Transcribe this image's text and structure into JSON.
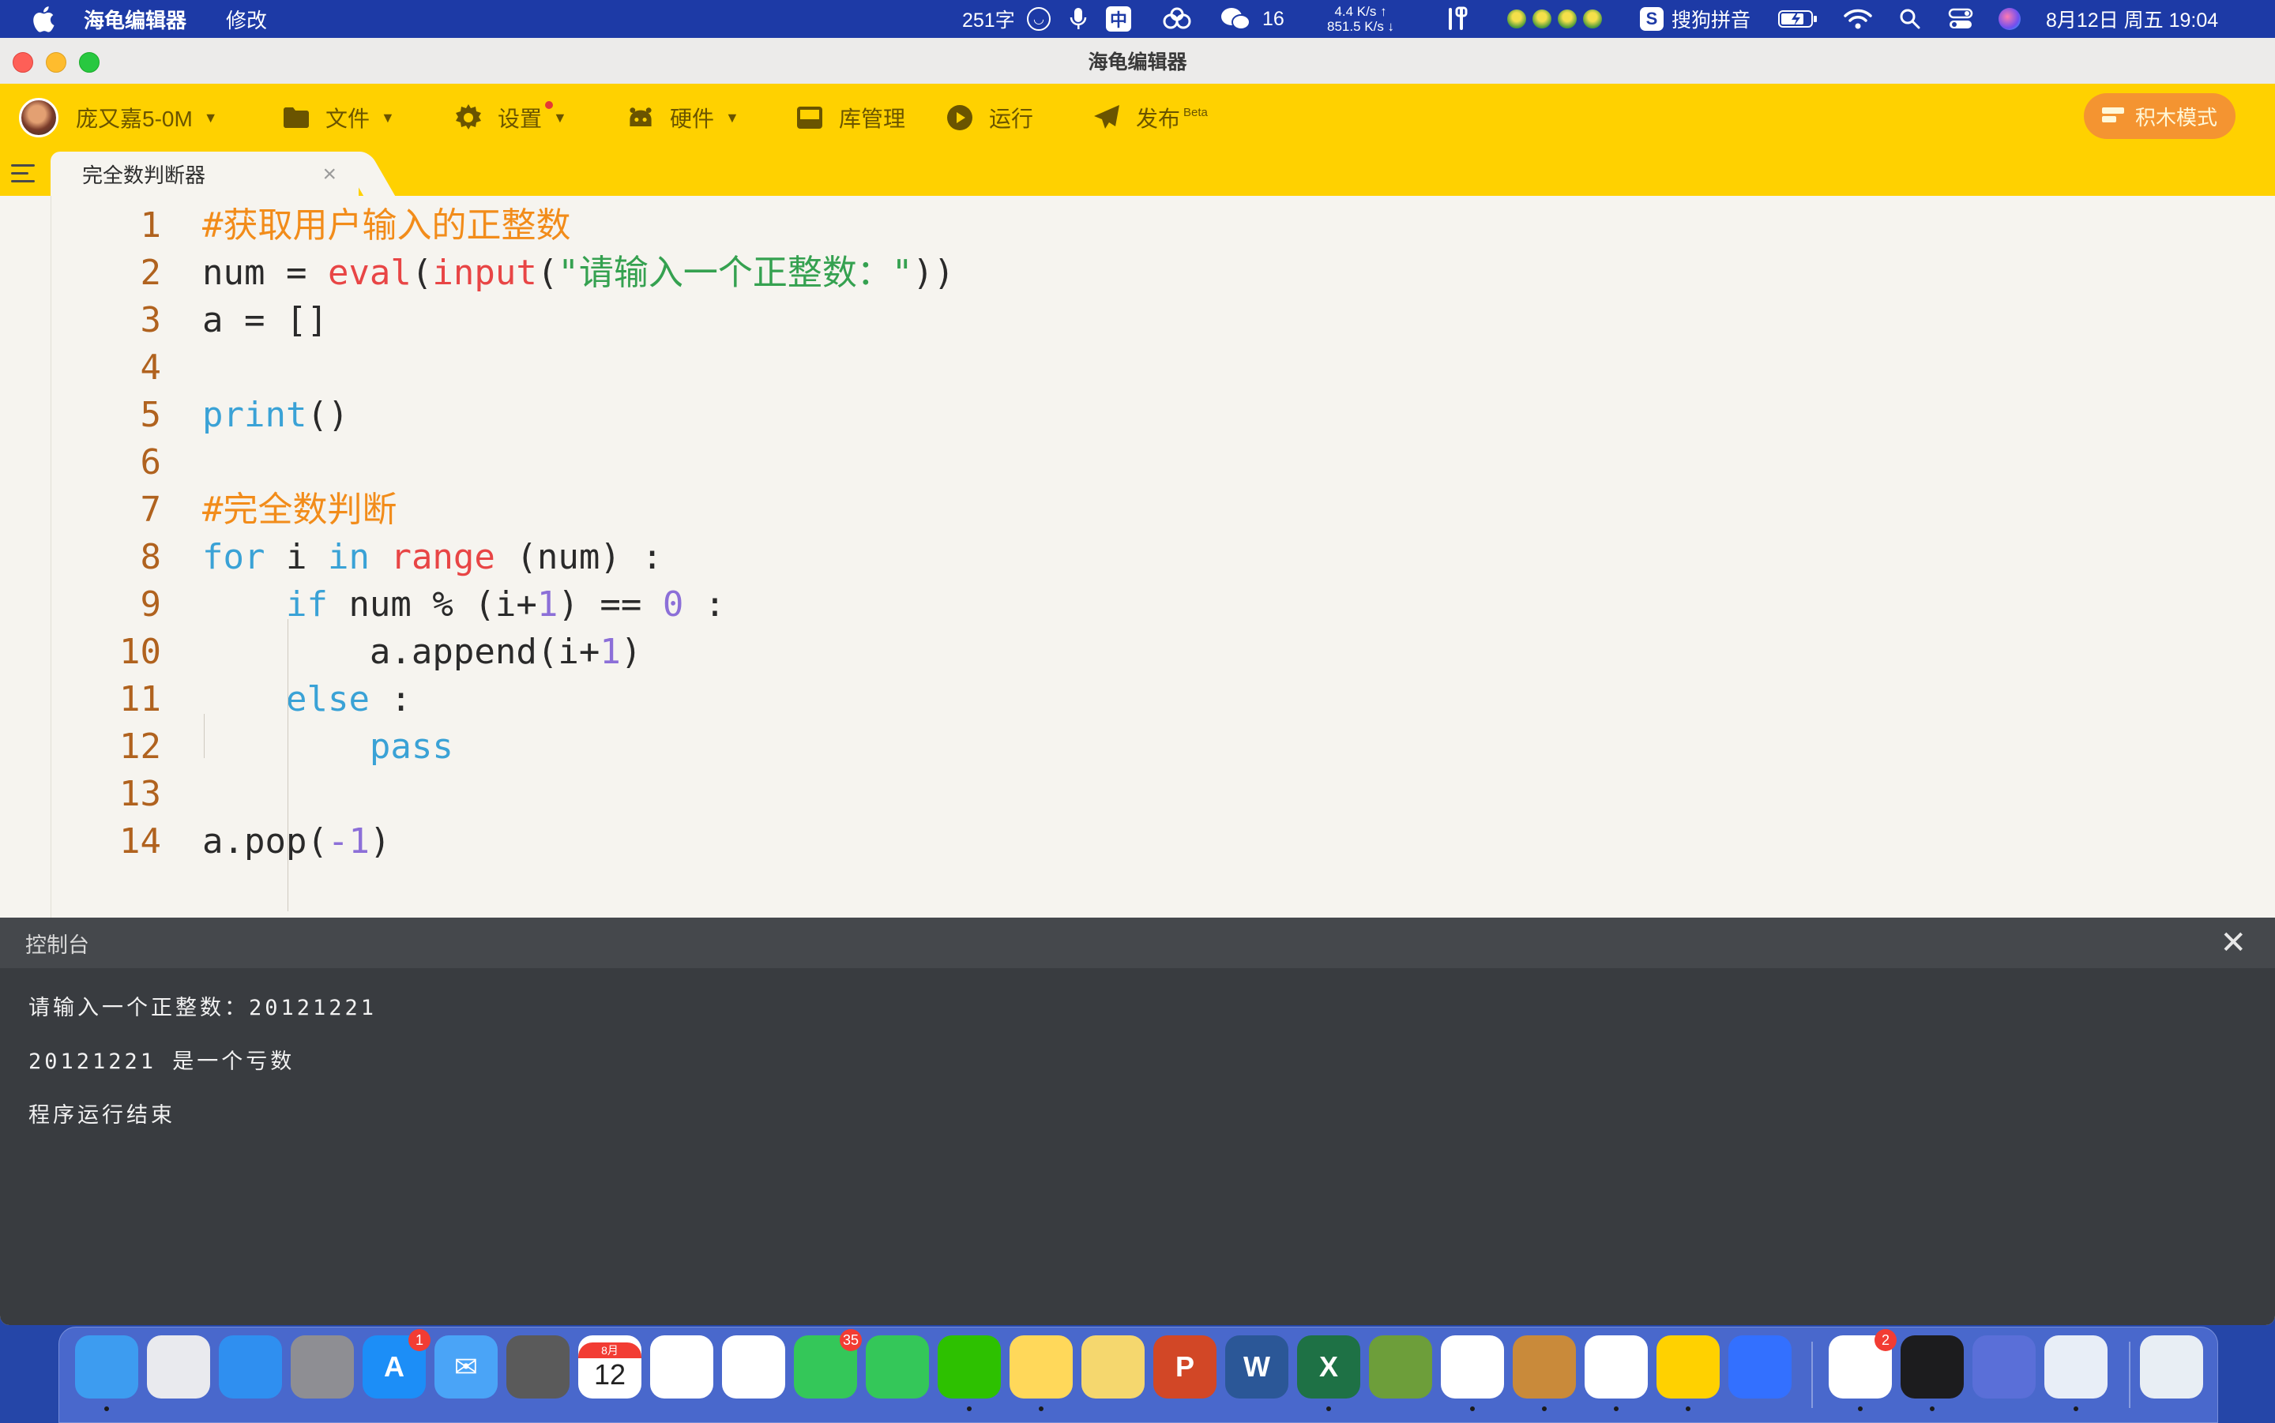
{
  "menubar": {
    "app_name": "海龟编辑器",
    "menu_edit": "修改",
    "word_count": "251字",
    "ime_mode": "中",
    "wechat_count": "16",
    "net_up": "4.4 K/s ↑",
    "net_down": "851.5 K/s ↓",
    "input_method": "搜狗拼音",
    "datetime": "8月12日 周五 19:04"
  },
  "window": {
    "title": "海龟编辑器"
  },
  "toolbar": {
    "user_name": "庞又嘉5-0M",
    "file": "文件",
    "settings": "设置",
    "hardware": "硬件",
    "library": "库管理",
    "run": "运行",
    "publish": "发布",
    "publish_badge": "Beta",
    "block_mode": "积木模式"
  },
  "tab": {
    "label": "完全数判断器",
    "close": "×"
  },
  "editor": {
    "lines": [
      {
        "n": "1",
        "tokens": [
          {
            "t": "#获取用户输入的正整数",
            "c": "comment"
          }
        ]
      },
      {
        "n": "2",
        "tokens": [
          {
            "t": "num = ",
            "c": "default"
          },
          {
            "t": "eval",
            "c": "builtin"
          },
          {
            "t": "(",
            "c": "default"
          },
          {
            "t": "input",
            "c": "builtin"
          },
          {
            "t": "(",
            "c": "default"
          },
          {
            "t": "\"请输入一个正整数：\"",
            "c": "string"
          },
          {
            "t": "))",
            "c": "default"
          }
        ]
      },
      {
        "n": "3",
        "tokens": [
          {
            "t": "a = []",
            "c": "default"
          }
        ]
      },
      {
        "n": "4",
        "tokens": []
      },
      {
        "n": "5",
        "tokens": [
          {
            "t": "print",
            "c": "keyword"
          },
          {
            "t": "()",
            "c": "default"
          }
        ]
      },
      {
        "n": "6",
        "tokens": []
      },
      {
        "n": "7",
        "tokens": [
          {
            "t": "#完全数判断",
            "c": "comment"
          }
        ]
      },
      {
        "n": "8",
        "tokens": [
          {
            "t": "for",
            "c": "keyword"
          },
          {
            "t": " i ",
            "c": "default"
          },
          {
            "t": "in",
            "c": "keyword"
          },
          {
            "t": " ",
            "c": "default"
          },
          {
            "t": "range",
            "c": "builtin"
          },
          {
            "t": " (num) :",
            "c": "default"
          }
        ]
      },
      {
        "n": "9",
        "tokens": [
          {
            "t": "    ",
            "c": "default"
          },
          {
            "t": "if",
            "c": "keyword"
          },
          {
            "t": " num % (i+",
            "c": "default"
          },
          {
            "t": "1",
            "c": "number"
          },
          {
            "t": ") == ",
            "c": "default"
          },
          {
            "t": "0",
            "c": "number"
          },
          {
            "t": " :",
            "c": "default"
          }
        ]
      },
      {
        "n": "10",
        "tokens": [
          {
            "t": "        a.append(i+",
            "c": "default"
          },
          {
            "t": "1",
            "c": "number"
          },
          {
            "t": ")",
            "c": "default"
          }
        ]
      },
      {
        "n": "11",
        "tokens": [
          {
            "t": "    ",
            "c": "default"
          },
          {
            "t": "else",
            "c": "keyword"
          },
          {
            "t": " :",
            "c": "default"
          }
        ]
      },
      {
        "n": "12",
        "tokens": [
          {
            "t": "        ",
            "c": "default"
          },
          {
            "t": "pass",
            "c": "keyword"
          }
        ]
      },
      {
        "n": "13",
        "tokens": []
      },
      {
        "n": "14",
        "tokens": [
          {
            "t": "a.pop(",
            "c": "default"
          },
          {
            "t": "-1",
            "c": "number"
          },
          {
            "t": ")",
            "c": "default"
          }
        ]
      }
    ],
    "run_button": "运行"
  },
  "console": {
    "title": "控制台",
    "close": "✕",
    "lines": [
      "请输入一个正整数：20121221",
      "20121221 是一个亏数",
      "程序运行结束"
    ]
  },
  "dock": {
    "items": [
      {
        "name": "finder",
        "label": "",
        "color": "#3d9cf0",
        "running": true
      },
      {
        "name": "launchpad",
        "label": "",
        "color": "#e9eaee",
        "running": false
      },
      {
        "name": "safari",
        "label": "",
        "color": "#2f8ff0",
        "running": false
      },
      {
        "name": "system-preferences",
        "label": "",
        "color": "#8e8e93",
        "running": false
      },
      {
        "name": "app-store",
        "label": "A",
        "color": "#1c8ef7",
        "running": false,
        "badge": "1"
      },
      {
        "name": "mail",
        "label": "✉",
        "color": "#4aa4f7",
        "running": false
      },
      {
        "name": "calculator",
        "label": "",
        "color": "#5a5a5a",
        "running": false
      },
      {
        "name": "calendar",
        "label": "12",
        "color": "#ffffff",
        "running": false,
        "sub": "8月"
      },
      {
        "name": "reminders",
        "label": "",
        "color": "#ffffff",
        "running": false
      },
      {
        "name": "photos",
        "label": "",
        "color": "#ffffff",
        "running": false
      },
      {
        "name": "messages",
        "label": "",
        "color": "#34c759",
        "running": false,
        "badge": "35"
      },
      {
        "name": "facetime",
        "label": "",
        "color": "#34c759",
        "running": false
      },
      {
        "name": "wechat",
        "label": "",
        "color": "#2dc100",
        "running": true
      },
      {
        "name": "notes",
        "label": "",
        "color": "#ffd85a",
        "running": true
      },
      {
        "name": "stickies",
        "label": "",
        "color": "#f5d76e",
        "running": false
      },
      {
        "name": "powerpoint",
        "label": "P",
        "color": "#d24726",
        "running": false
      },
      {
        "name": "word",
        "label": "W",
        "color": "#2b5797",
        "running": false
      },
      {
        "name": "excel",
        "label": "X",
        "color": "#1e7145",
        "running": true
      },
      {
        "name": "minecraft",
        "label": "",
        "color": "#6d9e3a",
        "running": false
      },
      {
        "name": "chrome",
        "label": "",
        "color": "#ffffff",
        "running": true
      },
      {
        "name": "books-stack",
        "label": "",
        "color": "#c98a3a",
        "running": true
      },
      {
        "name": "baidu-netdisk",
        "label": "",
        "color": "#ffffff",
        "running": true
      },
      {
        "name": "turtle-editor",
        "label": "",
        "color": "#ffd100",
        "running": true
      },
      {
        "name": "feishu",
        "label": "",
        "color": "#3370ff",
        "running": false
      },
      {
        "name": "microsoft-installer",
        "label": "",
        "color": "#ffffff",
        "running": true,
        "badge": "2"
      },
      {
        "name": "activity-monitor",
        "label": "",
        "color": "#1c1c1e",
        "running": true
      },
      {
        "name": "pixiu",
        "label": "",
        "color": "#5a6fd8",
        "running": false
      },
      {
        "name": "preview",
        "label": "",
        "color": "#e8eef7",
        "running": true
      },
      {
        "name": "trash",
        "label": "",
        "color": "#e8eef4",
        "running": false
      }
    ]
  }
}
